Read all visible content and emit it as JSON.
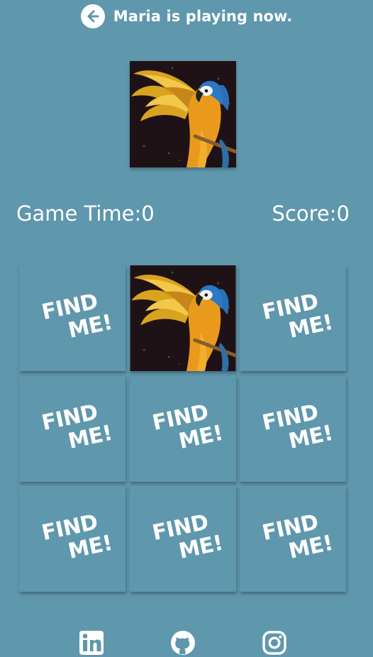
{
  "header": {
    "title": "Maria is playing now.",
    "back_icon": "arrow-left-circle-icon"
  },
  "target": {
    "image": "parrot-image"
  },
  "stats": {
    "time_label": "Game Time:",
    "time_value": "0",
    "score_label": "Score:",
    "score_value": "0"
  },
  "cards": [
    {
      "face": "hidden",
      "text_line1": "FIND",
      "text_line2": "ME!"
    },
    {
      "face": "parrot-image",
      "text_line1": "",
      "text_line2": ""
    },
    {
      "face": "hidden",
      "text_line1": "FIND",
      "text_line2": "ME!"
    },
    {
      "face": "hidden",
      "text_line1": "FIND",
      "text_line2": "ME!"
    },
    {
      "face": "hidden",
      "text_line1": "FIND",
      "text_line2": "ME!"
    },
    {
      "face": "hidden",
      "text_line1": "FIND",
      "text_line2": "ME!"
    },
    {
      "face": "hidden",
      "text_line1": "FIND",
      "text_line2": "ME!"
    },
    {
      "face": "hidden",
      "text_line1": "FIND",
      "text_line2": "ME!"
    },
    {
      "face": "hidden",
      "text_line1": "FIND",
      "text_line2": "ME!"
    }
  ],
  "footer": {
    "links": [
      "linkedin-icon",
      "github-icon",
      "instagram-icon"
    ]
  },
  "colors": {
    "background": "#5f97ad",
    "text": "#ffffff",
    "parrot_bg": "#1f1216"
  }
}
